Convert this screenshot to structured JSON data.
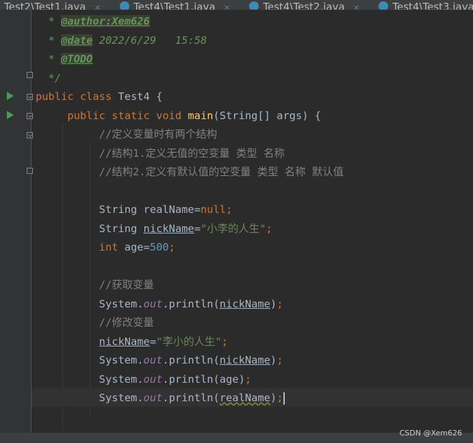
{
  "tabs": [
    {
      "label": "Test2\\Test1.java",
      "close": "×"
    },
    {
      "label": "Test4\\Test1.java",
      "close": "×"
    },
    {
      "label": "Test4\\Test2.java",
      "close": "×"
    },
    {
      "label": "Test4\\Test3.java",
      "close": "×"
    }
  ],
  "code": {
    "l1": {
      "star": "* ",
      "tag": "@author:Xem626"
    },
    "l2": {
      "star": "* ",
      "tag": "@date",
      "rest": " 2022/6/29   15:58"
    },
    "l3": {
      "star": "* ",
      "tag": "@TODO"
    },
    "l4": {
      "text": "*/"
    },
    "l5": {
      "kw": "public class ",
      "name": "Test4 {"
    },
    "l6": {
      "kw": "public static void ",
      "fn": "main",
      "rest": "(String[] args) {"
    },
    "l7": {
      "comment": "//定义变量时有两个结构"
    },
    "l8": {
      "comment": "//结构1.定义无值的空变量 类型 名称"
    },
    "l9": {
      "comment": "//结构2.定义有默认值的空变量 类型 名称 默认值"
    },
    "l11": {
      "type": "String ",
      "var": "realName",
      "eq": "=",
      "val": "null",
      "semi": ";"
    },
    "l12": {
      "type": "String ",
      "var": "nickName",
      "eq": "=",
      "val": "\"小李的人生\"",
      "semi": ";"
    },
    "l13": {
      "type": "int ",
      "var": "age",
      "eq": "=",
      "val": "500",
      "semi": ";"
    },
    "l15": {
      "comment": "//获取变量"
    },
    "l16": {
      "obj": "System.",
      "field": "out",
      "call": ".println(",
      "arg": "nickName",
      "close": ")",
      "semi": ";"
    },
    "l17": {
      "comment": "//修改变量"
    },
    "l18": {
      "var": "nickName",
      "eq": "=",
      "val": "\"李小的人生\"",
      "semi": ";"
    },
    "l19": {
      "obj": "System.",
      "field": "out",
      "call": ".println(",
      "arg": "nickName",
      "close": ")",
      "semi": ";"
    },
    "l20": {
      "obj": "System.",
      "field": "out",
      "call": ".println(",
      "arg": "age",
      "close": ")",
      "semi": ";"
    },
    "l21": {
      "obj": "System.",
      "field": "out",
      "call": ".println(",
      "arg": "realName",
      "close": ")",
      "semi": ";"
    }
  },
  "watermark": "CSDN @Xem626",
  "colors": {
    "background": "#2b2b2b",
    "keyword": "#cc7832",
    "string": "#6a8759",
    "number": "#6897bb",
    "comment": "#808080",
    "doc_comment": "#629755",
    "function": "#ffc66d",
    "static_field": "#9876aa"
  }
}
